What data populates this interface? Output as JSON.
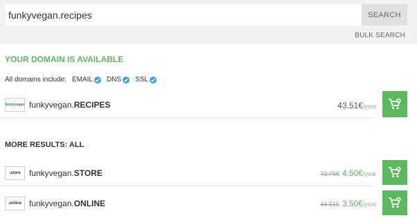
{
  "search": {
    "value": "funkyvegan.recipes",
    "button_label": "SEARCH",
    "bulk_label": "BULK SEARCH"
  },
  "available": {
    "title": "YOUR DOMAIN IS AVAILABLE",
    "includes_label": "All domains include:",
    "features": [
      "EMAIL",
      "DNS",
      "SSL"
    ]
  },
  "main_result": {
    "logo_text": "funkyvegan",
    "name": "funkyvegan.",
    "tld": "RECIPES",
    "price": "43.51€",
    "per": "/year"
  },
  "more_results": {
    "title": "MORE RESULTS: ALL",
    "items": [
      {
        "logo_text": ".store",
        "name": "funkyvegan.",
        "tld": "STORE",
        "old_price": "72.75€",
        "price": "4.50€",
        "per": "/year"
      },
      {
        "logo_text": ".online",
        "name": "funkyvegan.",
        "tld": "ONLINE",
        "old_price": "44.51€",
        "price": "3.50€",
        "per": "/year"
      }
    ]
  },
  "colors": {
    "accent_green": "#5cb85c",
    "check_blue": "#3ba3e3"
  }
}
